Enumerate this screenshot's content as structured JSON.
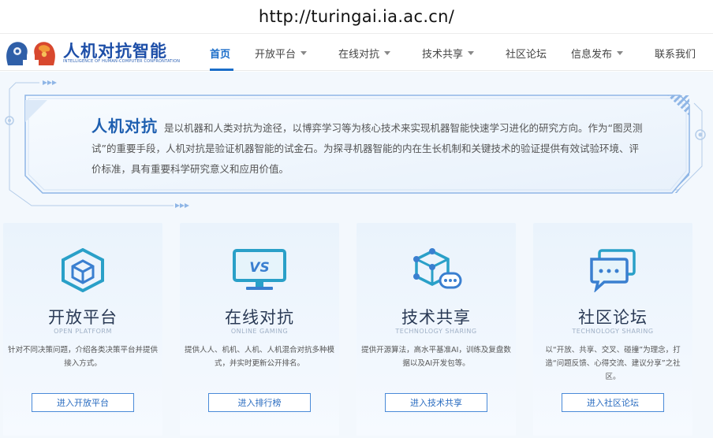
{
  "url": "http://turingai.ia.ac.cn/",
  "logo": {
    "title": "人机对抗智能",
    "subtitle": "INTELLIGENCE OF HUMAN-COMPUTER CONFRONTATION"
  },
  "nav": {
    "items": [
      {
        "label": "首页",
        "active": true,
        "dropdown": false
      },
      {
        "label": "开放平台",
        "active": false,
        "dropdown": true
      },
      {
        "label": "在线对抗",
        "active": false,
        "dropdown": true
      },
      {
        "label": "技术共享",
        "active": false,
        "dropdown": true
      },
      {
        "label": "社区论坛",
        "active": false,
        "dropdown": false
      },
      {
        "label": "信息发布",
        "active": false,
        "dropdown": true
      },
      {
        "label": "联系我们",
        "active": false,
        "dropdown": false
      }
    ]
  },
  "intro": {
    "title": "人机对抗",
    "text": "是以机器和人类对抗为途径，以博弈学习等为核心技术来实现机器智能快速学习进化的研究方向。作为“图灵测试”的重要手段，人机对抗是验证机器智能的试金石。为探寻机器智能的内在生长机制和关键技术的验证提供有效试验环境、评价标准，具有重要科学研究意义和应用价值。"
  },
  "cards": [
    {
      "title": "开放平台",
      "subtitle": "OPEN PLATFORM",
      "desc": "针对不同决策问题，介绍各类决策平台并提供接入方式。",
      "button": "进入开放平台",
      "icon": "cube-icon"
    },
    {
      "title": "在线对抗",
      "subtitle": "ONLINE GAMING",
      "desc": "提供人人、机机、人机、人机混合对抗多种模式，并实时更新公开排名。",
      "button": "进入排行榜",
      "icon": "vs-monitor-icon",
      "icon_text": "VS"
    },
    {
      "title": "技术共享",
      "subtitle": "TECHNOLOGY SHARING",
      "desc": "提供开源算法，高水平基准AI，训练及复盘数据以及AI开发包等。",
      "button": "进入技术共享",
      "icon": "network-cube-icon"
    },
    {
      "title": "社区论坛",
      "subtitle": "TECHNOLOGY SHARING",
      "desc": "以“开放、共享、交叉、碰撞”为理念，打造“问题反馈、心得交流、建议分享”之社区。",
      "button": "进入社区论坛",
      "icon": "chat-icon"
    }
  ],
  "colors": {
    "accent": "#1a6dc9",
    "banner_border": "#8fb6e6",
    "card_bg": "#eaf3fc"
  }
}
